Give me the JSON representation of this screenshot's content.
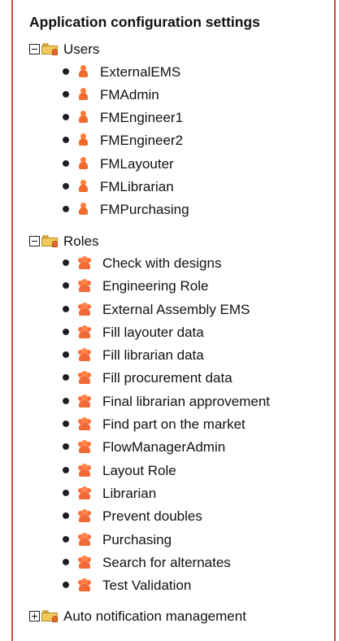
{
  "title": "Application configuration settings",
  "sections": [
    {
      "label": "Users",
      "expanded": true,
      "toggle": "minus",
      "icon": "users-folder-icon",
      "items": [
        "ExternalEMS",
        "FMAdmin",
        "FMEngineer1",
        "FMEngineer2",
        "FMLayouter",
        "FMLibrarian",
        "FMPurchasing"
      ]
    },
    {
      "label": "Roles",
      "expanded": true,
      "toggle": "minus",
      "icon": "roles-folder-icon",
      "items": [
        "Check with designs",
        "Engineering Role",
        "External Assembly EMS",
        "Fill layouter data",
        "Fill librarian data",
        "Fill procurement data",
        "Final librarian approvement",
        "Find part on the market",
        "FlowManagerAdmin",
        "Layout Role",
        "Librarian",
        "Prevent doubles",
        "Purchasing",
        "Search for alternates",
        "Test Validation"
      ]
    },
    {
      "label": "Auto notification management",
      "expanded": false,
      "toggle": "plus",
      "icon": "notification-folder-icon",
      "items": []
    }
  ],
  "colors": {
    "border": "#d84a4a",
    "folder": "#f0c95a",
    "user_icon": "#f26b2c",
    "role_icon": "#f06a38",
    "bullet": "#1d1d25"
  }
}
